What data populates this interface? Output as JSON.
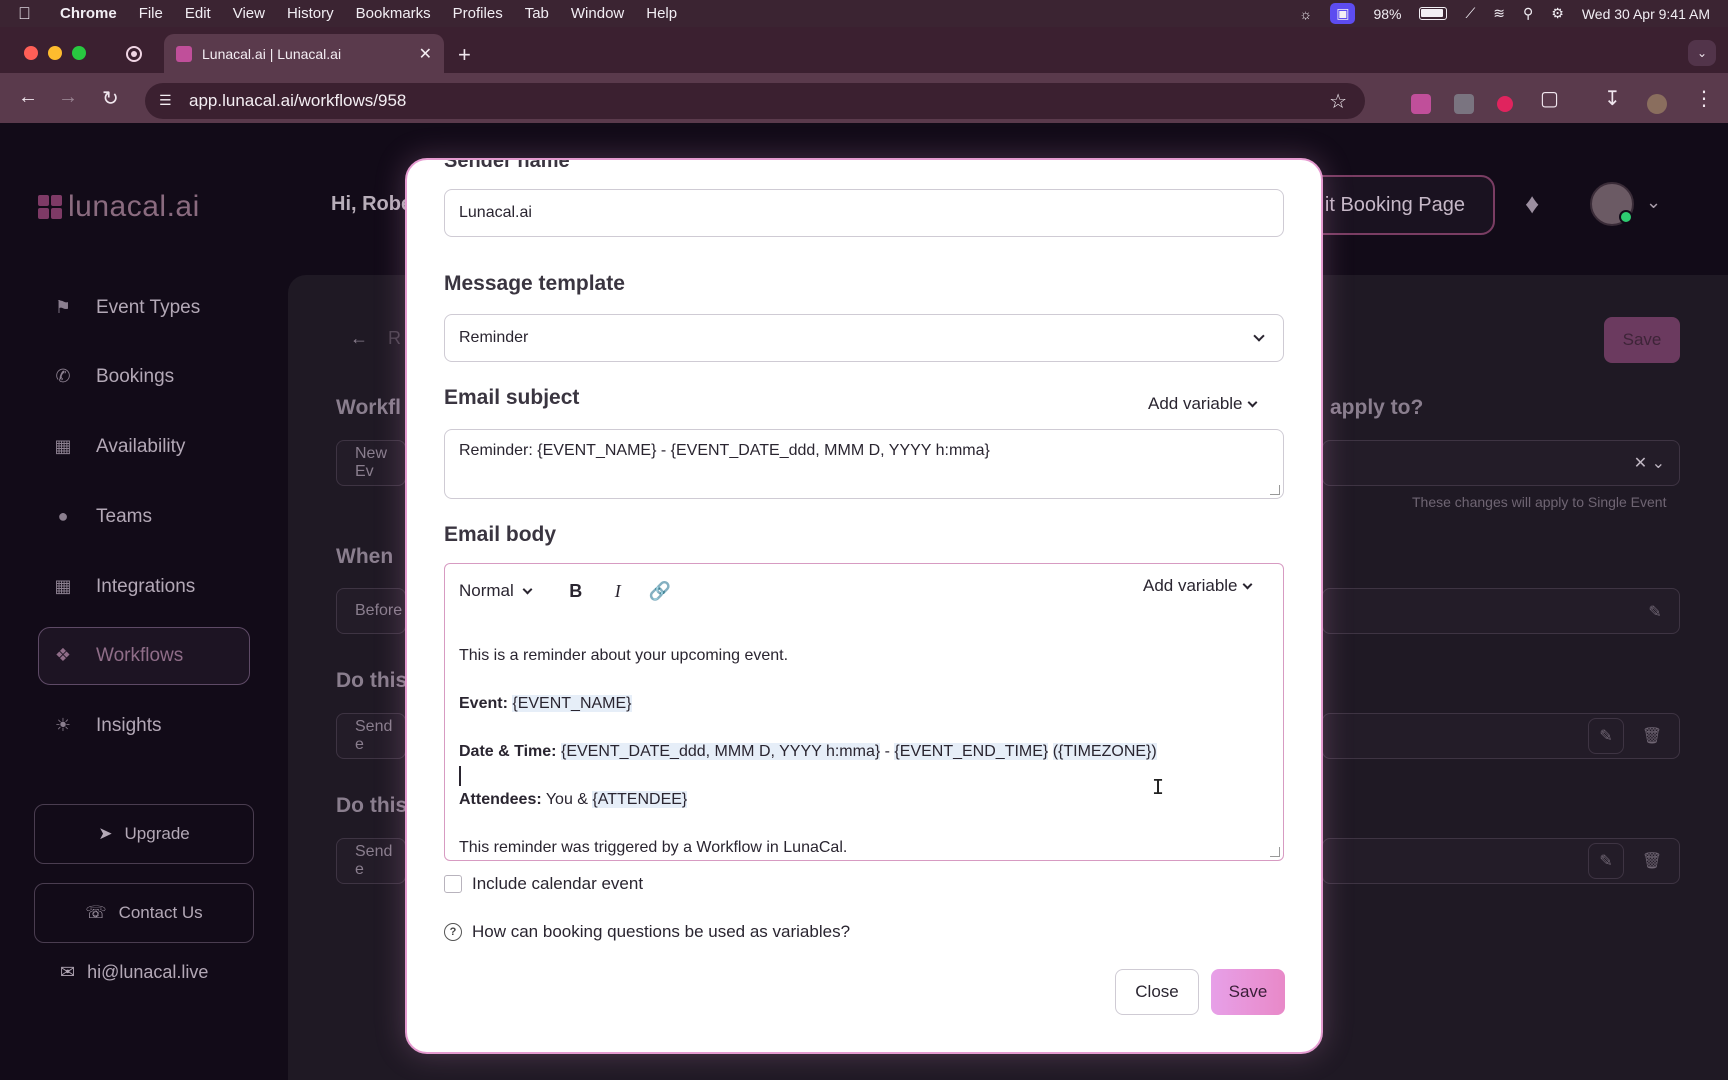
{
  "menubar": {
    "app": "Chrome",
    "items": [
      "File",
      "Edit",
      "View",
      "History",
      "Bookmarks",
      "Profiles",
      "Tab",
      "Window",
      "Help"
    ],
    "battery": "98%",
    "datetime": "Wed 30 Apr  9:41 AM"
  },
  "browser": {
    "tab_title": "Lunacal.ai | Lunacal.ai",
    "url": "app.lunacal.ai/workflows/958"
  },
  "app": {
    "logo_text": "lunacal.ai",
    "greeting": "Hi, Robe",
    "edit_booking_label": "it Booking Page",
    "sidebar": {
      "items": [
        {
          "label": "Event Types",
          "icon": "flag-icon"
        },
        {
          "label": "Bookings",
          "icon": "phone-icon"
        },
        {
          "label": "Availability",
          "icon": "calendar-icon"
        },
        {
          "label": "Teams",
          "icon": "people-icon"
        },
        {
          "label": "Integrations",
          "icon": "grid-icon"
        },
        {
          "label": "Workflows",
          "icon": "workflow-icon"
        },
        {
          "label": "Insights",
          "icon": "bulb-icon"
        }
      ],
      "upgrade": "Upgrade",
      "contact": "Contact Us",
      "email": "hi@lunacal.live"
    },
    "background": {
      "save": "Save",
      "workflow_label": "Workfl",
      "workflow_value": "New Ev",
      "apply_label": "apply to?",
      "apply_note": "These changes will apply to Single Event",
      "when_label": "When",
      "when_value": "Before",
      "do_this_1": "Do this",
      "send_1": "Send e",
      "do_this_2": "Do this",
      "send_2": "Send e",
      "back_letter": "R"
    }
  },
  "modal": {
    "sender_label": "Sender name",
    "sender_value": "Lunacal.ai",
    "template_label": "Message template",
    "template_value": "Reminder",
    "subject_label": "Email subject",
    "add_variable": "Add variable",
    "subject_value": "Reminder: {EVENT_NAME} - {EVENT_DATE_ddd, MMM D, YYYY h:mma}",
    "body_label": "Email body",
    "format_value": "Normal",
    "body": {
      "intro": "This is a reminder about your upcoming event.",
      "event_label": "Event:",
      "event_var": "{EVENT_NAME}",
      "datetime_label": "Date & Time:",
      "datetime_var1": "{EVENT_DATE_ddd, MMM D, YYYY h:mma}",
      "datetime_sep": " - ",
      "datetime_var2": "{EVENT_END_TIME}",
      "datetime_var3": "({TIMEZONE})",
      "attendees_label": "Attendees:",
      "attendees_text": " You & ",
      "attendees_var": "{ATTENDEE}",
      "footer": "This reminder was triggered by a Workflow in LunaCal."
    },
    "include_calendar": "Include calendar event",
    "help_text": "How can booking questions be used as variables?",
    "close": "Close",
    "save": "Save"
  }
}
